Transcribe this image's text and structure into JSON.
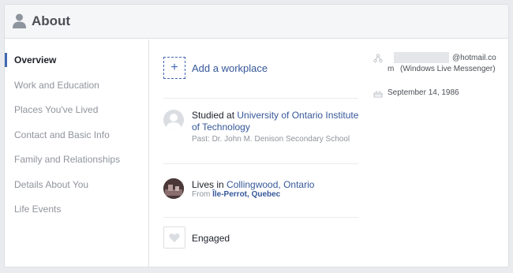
{
  "header": {
    "title": "About"
  },
  "sidebar": {
    "items": [
      {
        "label": "Overview",
        "active": true
      },
      {
        "label": "Work and Education"
      },
      {
        "label": "Places You've Lived"
      },
      {
        "label": "Contact and Basic Info"
      },
      {
        "label": "Family and Relationships"
      },
      {
        "label": "Details About You"
      },
      {
        "label": "Life Events"
      }
    ]
  },
  "overview": {
    "add_workplace": "Add a workplace",
    "education": {
      "prefix": "Studied at ",
      "school": "University of Ontario Institute of Technology",
      "past_prefix": "Past: ",
      "past_school": "Dr. John M. Denison Secondary School"
    },
    "residence": {
      "prefix": "Lives in ",
      "city": "Collingwood, Ontario",
      "from_prefix": "From ",
      "hometown": "Île-Perrot, Quebec"
    },
    "relationship": "Engaged"
  },
  "contact": {
    "email_domain_part1": "@hotmail.co",
    "email_domain_part2": "m",
    "email_service": "(Windows Live Messenger)",
    "birthday": "September 14, 1986"
  },
  "colors": {
    "accent": "#4267b2",
    "link": "#365899",
    "muted": "#90949c"
  }
}
